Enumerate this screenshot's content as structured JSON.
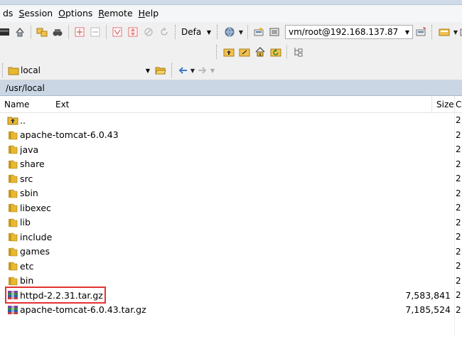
{
  "menubar": {
    "items": [
      {
        "label": "ds",
        "mnemonic_index": -1
      },
      {
        "label": "Session",
        "mnemonic_index": 0
      },
      {
        "label": "Options",
        "mnemonic_index": 0
      },
      {
        "label": "Remote",
        "mnemonic_index": 0
      },
      {
        "label": "Help",
        "mnemonic_index": 0
      }
    ]
  },
  "toolbar1": {
    "transfer_profile": "Defa",
    "session_combo": "vm/root@192.168.137.87"
  },
  "toolbar3": {
    "folder_combo": "local"
  },
  "path": "/usr/local",
  "columns": {
    "name": "Name",
    "ext": "Ext",
    "size": "Size",
    "changed": "C"
  },
  "files": [
    {
      "name": "..",
      "size": "",
      "changed": "2",
      "kind": "parent"
    },
    {
      "name": "apache-tomcat-6.0.43",
      "size": "",
      "changed": "2",
      "kind": "folder"
    },
    {
      "name": "java",
      "size": "",
      "changed": "2",
      "kind": "folder"
    },
    {
      "name": "share",
      "size": "",
      "changed": "2",
      "kind": "folder"
    },
    {
      "name": "src",
      "size": "",
      "changed": "2",
      "kind": "folder"
    },
    {
      "name": "sbin",
      "size": "",
      "changed": "2",
      "kind": "folder"
    },
    {
      "name": "libexec",
      "size": "",
      "changed": "2",
      "kind": "folder"
    },
    {
      "name": "lib",
      "size": "",
      "changed": "2",
      "kind": "folder"
    },
    {
      "name": "include",
      "size": "",
      "changed": "2",
      "kind": "folder"
    },
    {
      "name": "games",
      "size": "",
      "changed": "2",
      "kind": "folder"
    },
    {
      "name": "etc",
      "size": "",
      "changed": "2",
      "kind": "folder"
    },
    {
      "name": "bin",
      "size": "",
      "changed": "2",
      "kind": "folder"
    },
    {
      "name": "httpd-2.2.31.tar.gz",
      "size": "7,583,841",
      "changed": "2",
      "kind": "archive"
    },
    {
      "name": "apache-tomcat-6.0.43.tar.gz",
      "size": "7,185,524",
      "changed": "2",
      "kind": "archive"
    }
  ],
  "colors": {
    "accent_highlight": "#e53232",
    "path_bar": "#cad6e4",
    "folder": "#e8b830"
  }
}
